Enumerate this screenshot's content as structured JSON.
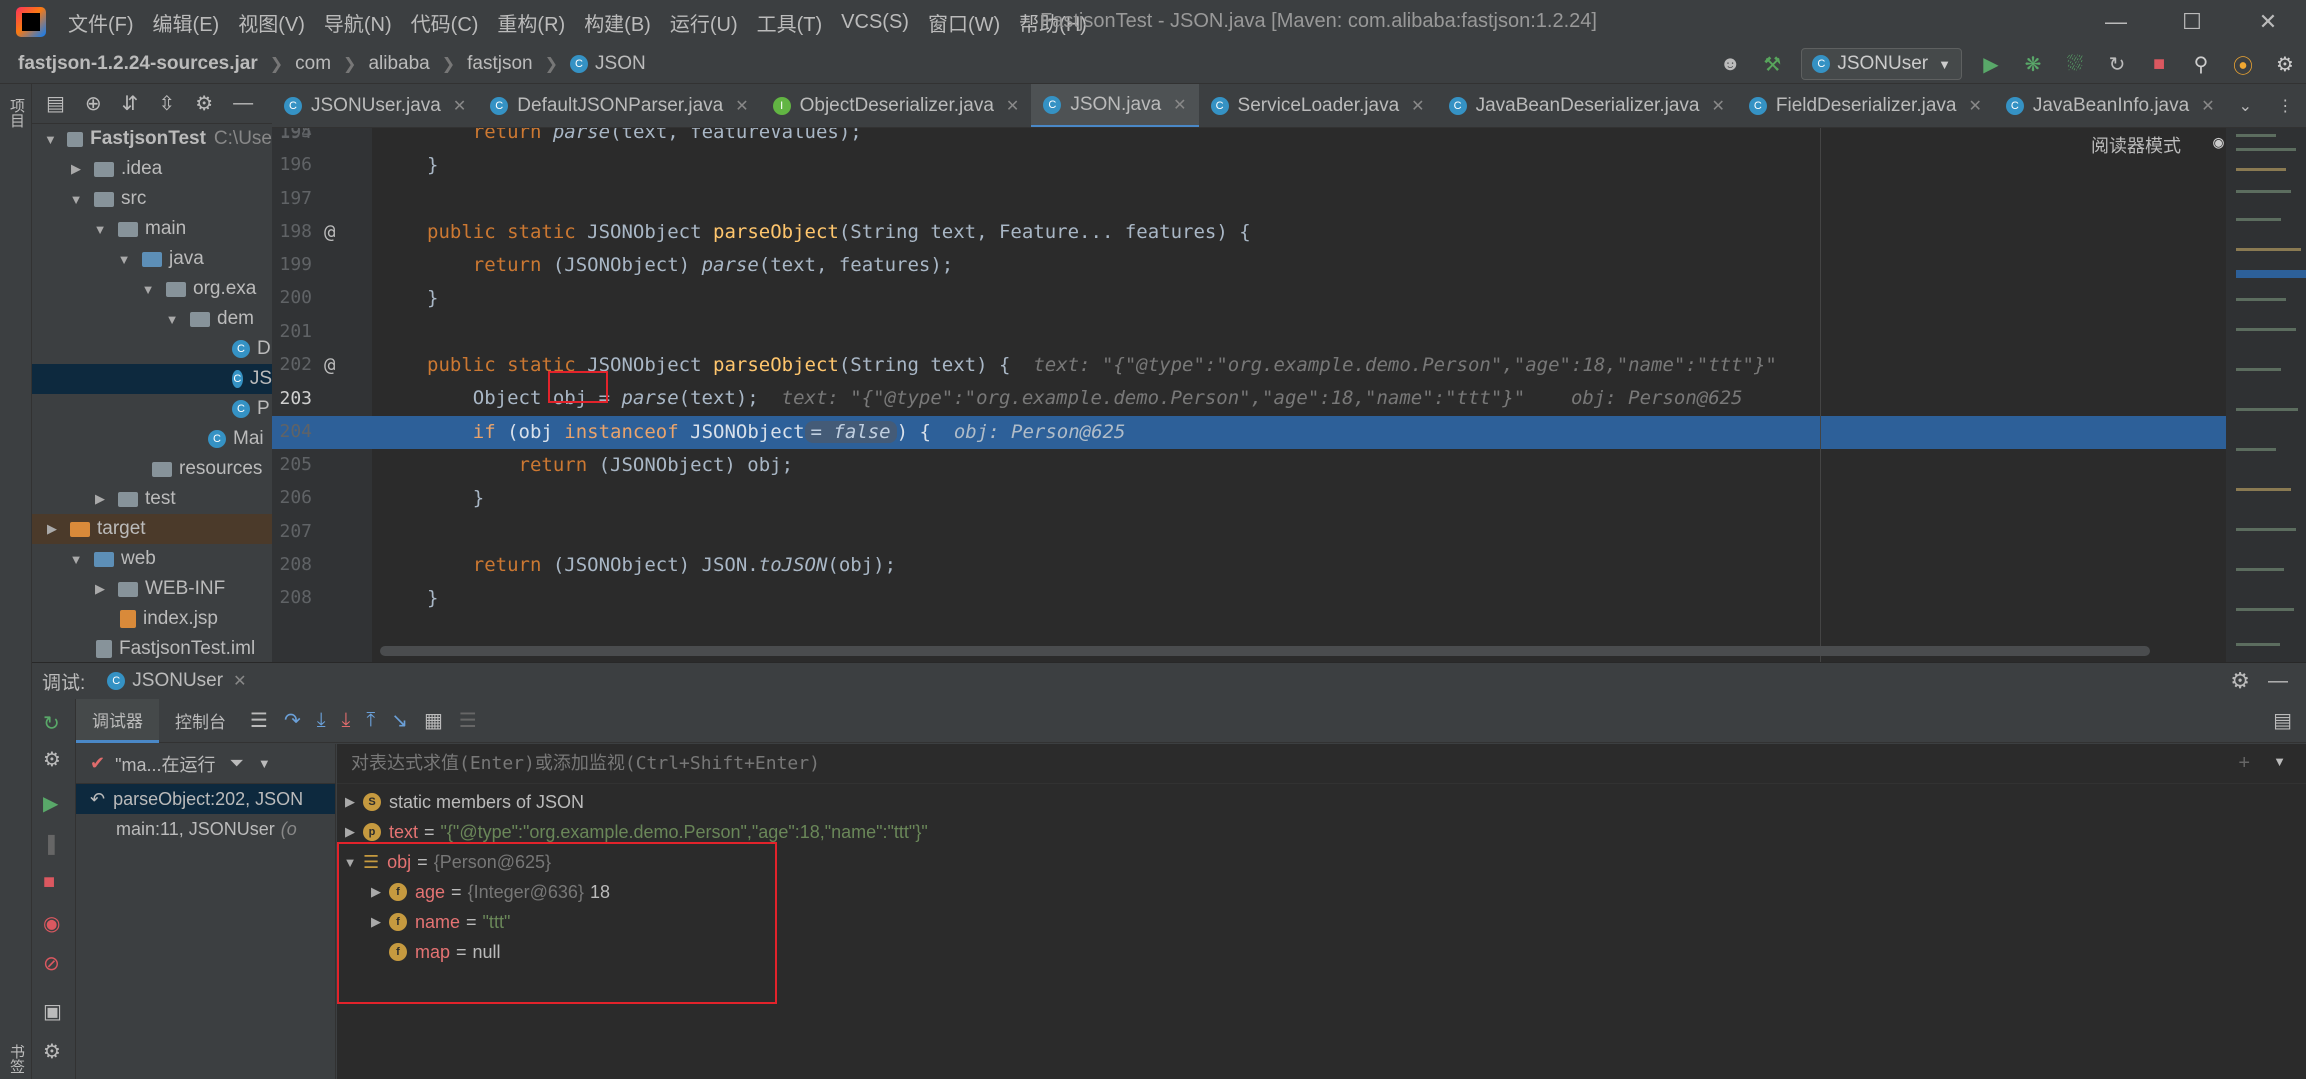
{
  "window": {
    "title": "FastjsonTest - JSON.java [Maven: com.alibaba:fastjson:1.2.24]",
    "menu": [
      "文件(F)",
      "编辑(E)",
      "视图(V)",
      "导航(N)",
      "代码(C)",
      "重构(R)",
      "构建(B)",
      "运行(U)",
      "工具(T)",
      "VCS(S)",
      "窗口(W)",
      "帮助(H)"
    ]
  },
  "nav": {
    "breadcrumbs": [
      "fastjson-1.2.24-sources.jar",
      "com",
      "alibaba",
      "fastjson",
      "JSON"
    ],
    "run_config": "JSONUser"
  },
  "sidebar": {
    "strip_labels": [
      "项目",
      "书签"
    ]
  },
  "project": {
    "items": [
      {
        "label": "FastjsonTest",
        "extra": "C:\\Use"
      },
      {
        "label": ".idea"
      },
      {
        "label": "src"
      },
      {
        "label": "main"
      },
      {
        "label": "java"
      },
      {
        "label": "org.exa"
      },
      {
        "label": "dem"
      },
      {
        "label": "D"
      },
      {
        "label": "JS"
      },
      {
        "label": "P"
      },
      {
        "label": "Mai"
      },
      {
        "label": "resources"
      },
      {
        "label": "test"
      },
      {
        "label": "target"
      },
      {
        "label": "web"
      },
      {
        "label": "WEB-INF"
      },
      {
        "label": "index.jsp"
      },
      {
        "label": "FastjsonTest.iml"
      }
    ]
  },
  "tabs": [
    "JSONUser.java",
    "DefaultJSONParser.java",
    "ObjectDeserializer.java",
    "JSON.java",
    "ServiceLoader.java",
    "JavaBeanDeserializer.java",
    "FieldDeserializer.java",
    "JavaBeanInfo.java"
  ],
  "editor": {
    "reader_mode": "阅读器模式",
    "lines": {
      "n194": "194",
      "n195": "195",
      "n196": "196",
      "n197": "197",
      "n198": "198",
      "n199": "199",
      "n200": "200",
      "n201": "201",
      "n202": "202",
      "n203": "203",
      "n204": "204",
      "n205": "205",
      "n206": "206",
      "n207": "207",
      "n208": "208"
    },
    "hint_text": "text: \"{\"@type\":\"org.example.demo.Person\",\"age\":18,\"name\":\"ttt\"}\"",
    "hint_obj": "obj: Person@625",
    "chip_false": "= false"
  },
  "debug": {
    "label": "调试:",
    "session": "JSONUser",
    "tab_debugger": "调试器",
    "tab_console": "控制台",
    "thread": "\"ma...在运行",
    "frames": [
      "parseObject:202, JSON",
      "main:11, JSONUser"
    ],
    "frame_extra": "(o",
    "eval_placeholder": "对表达式求值(Enter)或添加监视(Ctrl+Shift+Enter)",
    "vars": {
      "static_name": "static members of JSON",
      "text_name": "text",
      "text_value": "\"{\"@type\":\"org.example.demo.Person\",\"age\":18,\"name\":\"ttt\"}\"",
      "obj_name": "obj",
      "obj_value": "{Person@625}",
      "age_name": "age",
      "age_type": "{Integer@636}",
      "age_value": "18",
      "name_name": "name",
      "name_value": "\"ttt\"",
      "map_name": "map",
      "map_value": "null"
    }
  }
}
